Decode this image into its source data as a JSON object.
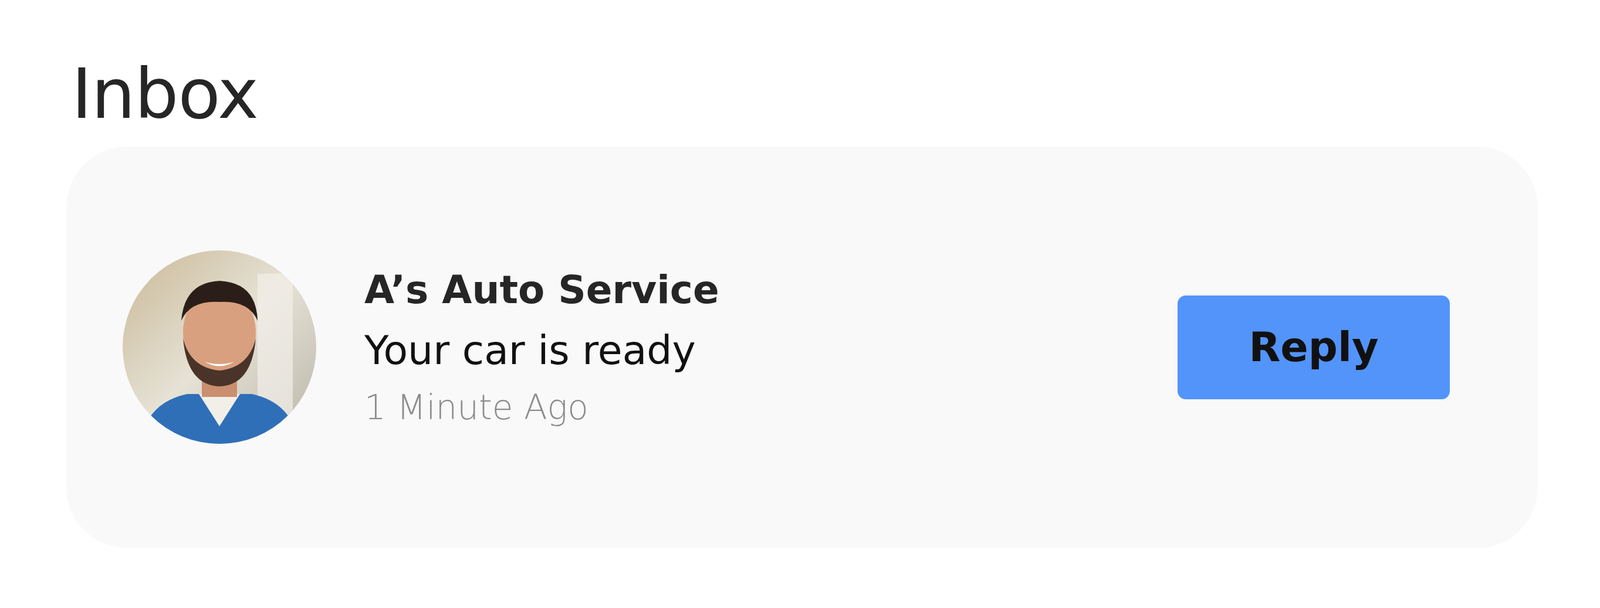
{
  "title": "Inbox",
  "messages": [
    {
      "sender": "A’s Auto Service",
      "text": "Your car is ready",
      "time": "1 Minute Ago",
      "action": "Reply"
    }
  ]
}
